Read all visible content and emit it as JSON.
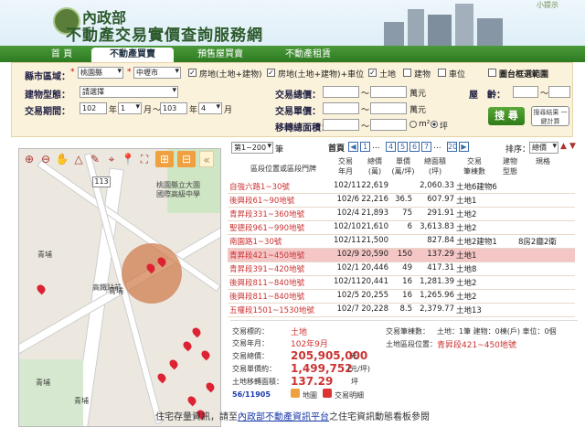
{
  "header": {
    "title_line1": "內政部",
    "title_line2": "不動產交易實價查詢服務網",
    "tip": "小提示"
  },
  "tabs": [
    "首 頁",
    "不動產買賣",
    "預售屋買賣",
    "不動產租賃"
  ],
  "search": {
    "county_label": "縣市區域：",
    "county": "桃園縣",
    "district": "中壢市",
    "types": [
      "房地(土地+建物)",
      "房地(土地+建物)+車位",
      "土地",
      "建物",
      "車位"
    ],
    "types_checked": [
      true,
      true,
      true,
      false,
      false
    ],
    "map_range_label": "圖台框選範圍",
    "building_label": "建物型態：",
    "building_value": "請選擇",
    "total_label": "交易總價：",
    "total_unit": "萬元",
    "age_label": "屋　齡：",
    "age_sep": "～",
    "unit_label": "交易單價：",
    "unit_unit": "萬元",
    "area_label": "移轉總面積：",
    "area_opt1": "m²",
    "area_opt2": "坪",
    "period_label": "交易期間：",
    "y1": "102",
    "m1": "1",
    "y2": "103",
    "m2": "4",
    "year_unit": "年",
    "month_unit": "月",
    "to": "～",
    "search_btn": "搜 尋",
    "calc_btn": "搜尋結果 一鍵計算"
  },
  "map": {
    "labels": [
      "桃園縣立大園",
      "國際高級中學",
      "高鐵站前",
      "青埔",
      "青埔",
      "青埔",
      "青埔"
    ],
    "road_no": "113"
  },
  "list": {
    "range": "第1~200",
    "range_unit": "筆",
    "first": "首頁",
    "pages": [
      "1",
      "4",
      "5",
      "6",
      "7",
      "20"
    ],
    "sort_label": "排序：",
    "sort_value": "總價",
    "headers": [
      "區段位置或區段門牌",
      "交易\n年月",
      "總價\n(萬)",
      "單價\n(萬/坪)",
      "總面積\n(坪)",
      "交易\n筆棟數",
      "建物\n型態",
      "規格"
    ],
    "rows": [
      {
        "addr": "自強六路1~30號",
        "ym": "102/11",
        "total": "22,619",
        "unit": "",
        "area": "2,060.33",
        "cnt": "土地6建物6",
        "type": "",
        "spec": ""
      },
      {
        "addr": "後興段61~90地號",
        "ym": "102/6",
        "total": "22,216",
        "unit": "36.5",
        "area": "607.97",
        "cnt": "土地1",
        "type": "",
        "spec": ""
      },
      {
        "addr": "青昇段331~360地號",
        "ym": "102/4",
        "total": "21,893",
        "unit": "75",
        "area": "291.91",
        "cnt": "土地2",
        "type": "",
        "spec": ""
      },
      {
        "addr": "聖德段961~990地號",
        "ym": "102/10",
        "total": "21,610",
        "unit": "6",
        "area": "3,613.83",
        "cnt": "土地2",
        "type": "",
        "spec": ""
      },
      {
        "addr": "南園路1~30號",
        "ym": "102/11",
        "total": "21,500",
        "unit": "",
        "area": "827.84",
        "cnt": "土地2建物1",
        "type": "",
        "spec": "8房2廳2衛"
      },
      {
        "addr": "青昇段421~450地號",
        "ym": "102/9",
        "total": "20,590",
        "unit": "150",
        "area": "137.29",
        "cnt": "土地1",
        "type": "",
        "spec": ""
      },
      {
        "addr": "青昇段391~420地號",
        "ym": "102/1",
        "total": "20,446",
        "unit": "49",
        "area": "417.31",
        "cnt": "土地8",
        "type": "",
        "spec": ""
      },
      {
        "addr": "後興段811~840地號",
        "ym": "102/11",
        "total": "20,441",
        "unit": "16",
        "area": "1,281.39",
        "cnt": "土地2",
        "type": "",
        "spec": ""
      },
      {
        "addr": "後興段811~840地號",
        "ym": "102/5",
        "total": "20,255",
        "unit": "16",
        "area": "1,265.96",
        "cnt": "土地2",
        "type": "",
        "spec": ""
      },
      {
        "addr": "五權段1501~1530地號",
        "ym": "102/7",
        "total": "20,228",
        "unit": "8.5",
        "area": "2,379.77",
        "cnt": "土地13",
        "type": "",
        "spec": ""
      }
    ]
  },
  "detail": {
    "type_label": "交易標的：",
    "type_value": "土地",
    "ym_label": "交易年月：",
    "ym_value": "102年9月",
    "total_label": "交易總價：",
    "total_value": "205,905,000",
    "total_unit": "元",
    "unit_label": "交易單價約：",
    "unit_value": "1,499,752",
    "unit_unit": "(元/坪)",
    "area_label": "土地移轉面積：",
    "area_value": "137.29",
    "area_unit": "坪",
    "counts_label": "交易筆棟數：",
    "counts_value": "土地：1筆 建物：0棟(戶) 車位：0個",
    "loc_label": "土地區段位置：",
    "loc_value": "青昇段421~450地號",
    "index": "56/11905",
    "map_btn": "地圖",
    "note_btn": "交易明細"
  },
  "footer": {
    "pre": "住宅存量資訊，請至",
    "link": "內政部不動產資訊平台",
    "post": "之住宅資訊動態看板參閱"
  }
}
